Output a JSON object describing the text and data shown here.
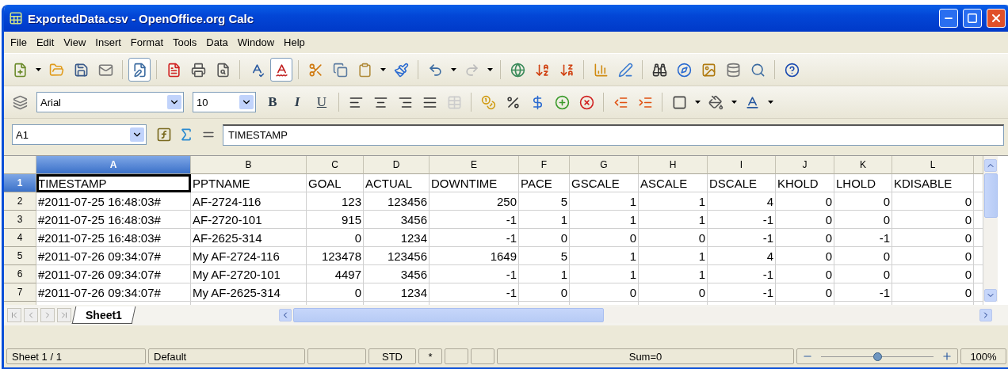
{
  "window": {
    "title": "ExportedData.csv - OpenOffice.org Calc"
  },
  "menu": [
    "File",
    "Edit",
    "View",
    "Insert",
    "Format",
    "Tools",
    "Data",
    "Window",
    "Help"
  ],
  "formatting": {
    "font": "Arial",
    "size": "10",
    "bold": "B",
    "italic": "I",
    "underline": "U"
  },
  "formula_bar": {
    "cell_ref": "A1",
    "content": "TIMESTAMP"
  },
  "sheet": {
    "columns": [
      {
        "label": "A",
        "kind": "text",
        "selected": true
      },
      {
        "label": "B",
        "kind": "text",
        "selected": false
      },
      {
        "label": "C",
        "kind": "number",
        "selected": false
      },
      {
        "label": "D",
        "kind": "number",
        "selected": false
      },
      {
        "label": "E",
        "kind": "number",
        "selected": false
      },
      {
        "label": "F",
        "kind": "number",
        "selected": false
      },
      {
        "label": "G",
        "kind": "number",
        "selected": false
      },
      {
        "label": "H",
        "kind": "number",
        "selected": false
      },
      {
        "label": "I",
        "kind": "number",
        "selected": false
      },
      {
        "label": "J",
        "kind": "number",
        "selected": false
      },
      {
        "label": "K",
        "kind": "number",
        "selected": false
      },
      {
        "label": "L",
        "kind": "number",
        "selected": false
      }
    ],
    "rows": [
      {
        "label": "1",
        "kind": "header",
        "selected": true,
        "cells": [
          "TIMESTAMP",
          "PPTNAME",
          "GOAL",
          "ACTUAL",
          "DOWNTIME",
          "PACE",
          "GSCALE",
          "ASCALE",
          "DSCALE",
          "KHOLD",
          "LHOLD",
          "KDISABLE"
        ]
      },
      {
        "label": "2",
        "kind": "data",
        "selected": false,
        "cells": [
          "#2011-07-25 16:48:03#",
          "AF-2724-116",
          "123",
          "123456",
          "250",
          "5",
          "1",
          "1",
          "4",
          "0",
          "0",
          "0"
        ]
      },
      {
        "label": "3",
        "kind": "data",
        "selected": false,
        "cells": [
          "#2011-07-25 16:48:03#",
          "AF-2720-101",
          "915",
          "3456",
          "-1",
          "1",
          "1",
          "1",
          "-1",
          "0",
          "0",
          "0"
        ]
      },
      {
        "label": "4",
        "kind": "data",
        "selected": false,
        "cells": [
          "#2011-07-25 16:48:03#",
          "AF-2625-314",
          "0",
          "1234",
          "-1",
          "0",
          "0",
          "0",
          "-1",
          "0",
          "-1",
          "0"
        ]
      },
      {
        "label": "5",
        "kind": "data",
        "selected": false,
        "cells": [
          "#2011-07-26 09:34:07#",
          "My AF-2724-116",
          "123478",
          "123456",
          "1649",
          "5",
          "1",
          "1",
          "4",
          "0",
          "0",
          "0"
        ]
      },
      {
        "label": "6",
        "kind": "data",
        "selected": false,
        "cells": [
          "#2011-07-26 09:34:07#",
          "My AF-2720-101",
          "4497",
          "3456",
          "-1",
          "1",
          "1",
          "1",
          "-1",
          "0",
          "0",
          "0"
        ]
      },
      {
        "label": "7",
        "kind": "data",
        "selected": false,
        "cells": [
          "#2011-07-26 09:34:07#",
          "My AF-2625-314",
          "0",
          "1234",
          "-1",
          "0",
          "0",
          "0",
          "-1",
          "0",
          "-1",
          "0"
        ]
      }
    ],
    "tabs": [
      {
        "label": "Sheet1",
        "selected": true
      }
    ]
  },
  "status_bar": {
    "sheet": "Sheet 1 / 1",
    "style": "Default",
    "mode": "STD",
    "modified": "*",
    "sum": "Sum=0",
    "zoom": {
      "level": 0.5,
      "reading": "100%"
    }
  }
}
